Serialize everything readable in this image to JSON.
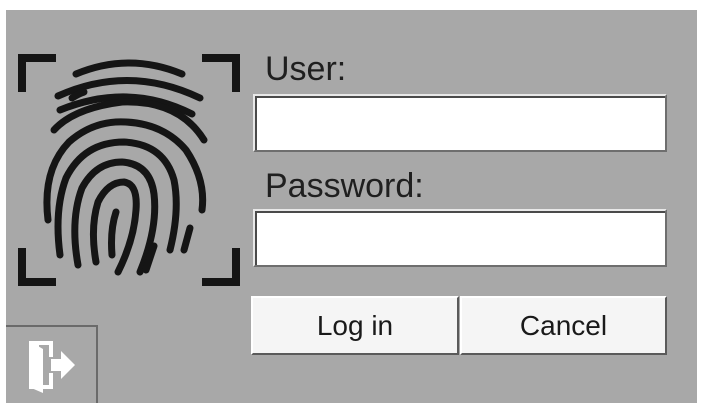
{
  "login": {
    "user_label": "User:",
    "user_value": "",
    "password_label": "Password:",
    "password_value": "",
    "login_label": "Log in",
    "cancel_label": "Cancel"
  },
  "icons": {
    "biometric": "fingerprint-icon",
    "exit": "exit-door-icon"
  },
  "colors": {
    "panel_background": "#a8a8a8",
    "icon_stroke": "#151515"
  }
}
